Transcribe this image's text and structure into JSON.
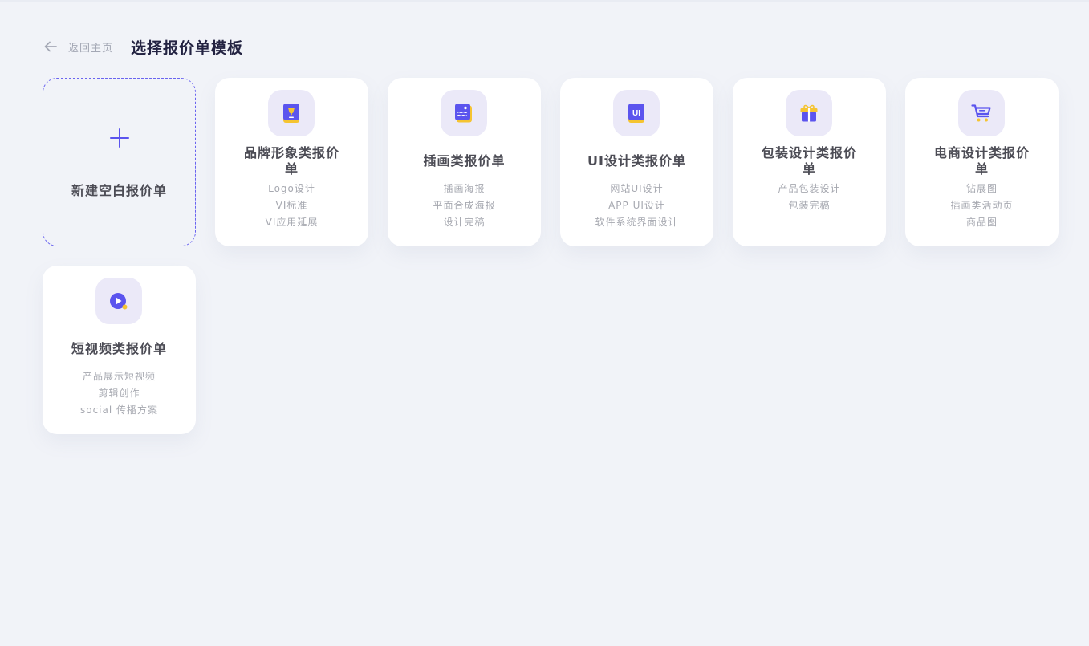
{
  "header": {
    "back_label": "返回主页",
    "title": "选择报价单模板"
  },
  "new_card": {
    "label": "新建空白报价单"
  },
  "templates": [
    {
      "title": "品牌形象类报价单",
      "items": [
        "Logo设计",
        "VI标准",
        "VI应用延展"
      ],
      "icon": "brand-book-icon"
    },
    {
      "title": "插画类报价单",
      "items": [
        "插画海报",
        "平面合成海报",
        "设计完稿"
      ],
      "icon": "illustration-icon"
    },
    {
      "title": "UI设计类报价单",
      "items": [
        "网站UI设计",
        "APP UI设计",
        "软件系统界面设计"
      ],
      "icon": "ui-book-icon",
      "icon_text": "UI"
    },
    {
      "title": "包装设计类报价单",
      "items": [
        "产品包装设计",
        "包装完稿"
      ],
      "icon": "gift-icon"
    },
    {
      "title": "电商设计类报价单",
      "items": [
        "钻展图",
        "插画类活动页",
        "商品图"
      ],
      "icon": "shopping-cart-icon"
    },
    {
      "title": "短视频类报价单",
      "items": [
        "产品展示短视频",
        "剪辑创作",
        "social 传播方案"
      ],
      "icon": "video-play-icon"
    }
  ],
  "colors": {
    "background": "#f1f3f8",
    "accent": "#5b54ee",
    "icon_bg": "#ebe9f8",
    "icon_accent": "#f5c431",
    "title": "#232342",
    "muted": "#a6a8b0"
  }
}
